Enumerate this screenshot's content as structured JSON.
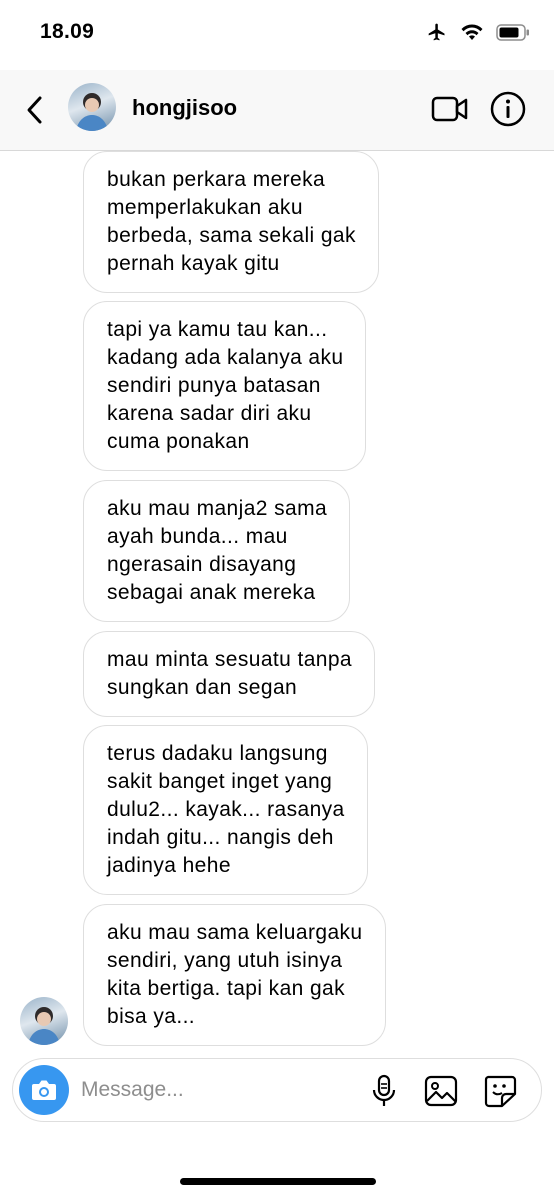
{
  "status_bar": {
    "time": "18.09"
  },
  "header": {
    "username": "hongjisoo"
  },
  "messages": [
    {
      "text": "bukan perkara mereka\nmemperlakukan aku\nberbeda, sama sekali gak\npernah kayak gitu"
    },
    {
      "text": "tapi ya kamu tau kan...\nkadang ada kalanya aku\nsendiri punya batasan\nkarena sadar diri aku\ncuma ponakan"
    },
    {
      "text": "aku mau manja2 sama\nayah bunda... mau\nngerasain disayang\nsebagai anak mereka"
    },
    {
      "text": "mau minta sesuatu tanpa\nsungkan dan segan"
    },
    {
      "text": "terus dadaku langsung\nsakit banget inget yang\ndulu2... kayak... rasanya\nindah gitu... nangis deh\njadinya hehe"
    },
    {
      "text": "aku mau sama keluargaku\nsendiri, yang utuh isinya\nkita bertiga. tapi kan gak\nbisa ya..."
    }
  ],
  "composer": {
    "placeholder": "Message..."
  },
  "icons": {
    "airplane": "airplane-icon",
    "wifi": "wifi-icon",
    "battery": "battery-icon",
    "back": "chevron-left-icon",
    "video": "video-camera-icon",
    "info": "info-icon",
    "camera": "camera-icon",
    "microphone": "microphone-icon",
    "gallery": "image-gallery-icon",
    "sticker": "sticker-icon"
  },
  "colors": {
    "accent": "#3797f0",
    "bubble_border": "#dedede",
    "placeholder": "#8e8e8e"
  }
}
